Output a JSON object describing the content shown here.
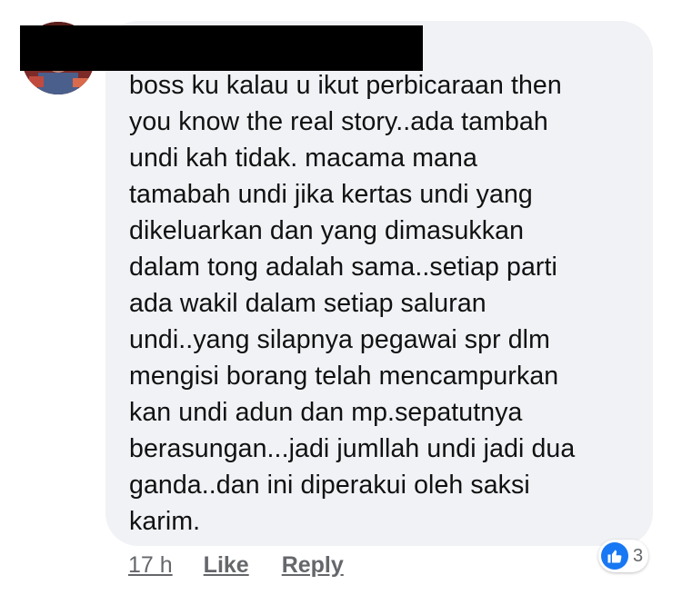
{
  "comment": {
    "author_name": "",
    "lines": [
      "boss ku kalau u ikut perbicaraan then",
      "you know the real story..ada tambah",
      "undi kah tidak. macama mana",
      "tamabah undi jika kertas undi yang",
      "dikeluarkan dan yang dimasukkan",
      "dalam tong adalah sama..setiap parti",
      "ada wakil dalam setiap saluran",
      "undi..yang silapnya pegawai spr dlm",
      "mengisi borang telah mencampurkan",
      "kan undi adun dan mp.sepatutnya",
      "berasungan...jadi jumllah undi jadi dua",
      "ganda..dan ini diperakui oleh saksi",
      "karim."
    ]
  },
  "actions": {
    "time": "17 h",
    "like_label": "Like",
    "reply_label": "Reply"
  },
  "reactions": {
    "icon": "like-icon",
    "count": "3"
  },
  "colors": {
    "bubble": "#f0f2f5",
    "text": "#111111",
    "meta": "#65676b",
    "like_blue": "#1877f2",
    "redaction": "#000000"
  }
}
